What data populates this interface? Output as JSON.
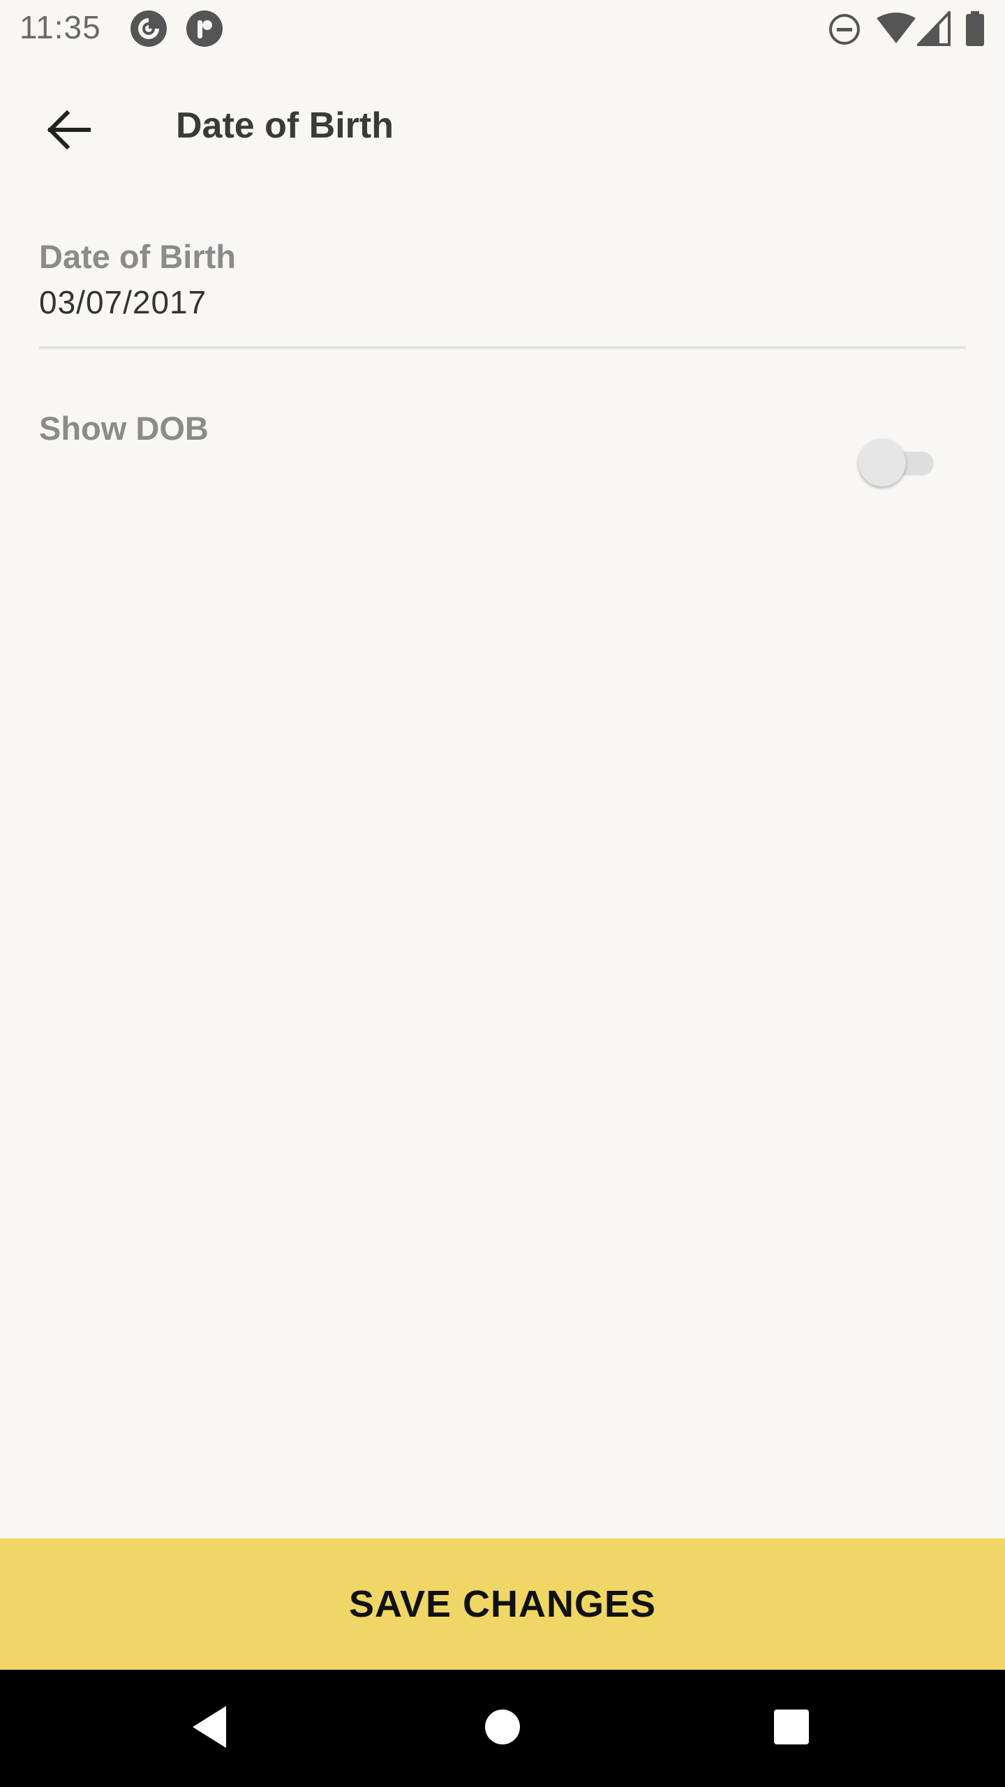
{
  "status_bar": {
    "time": "11:35",
    "left_icons": [
      "pocket-casts-icon",
      "app-r-icon"
    ],
    "right_icons": [
      "do-not-disturb-icon",
      "wifi-icon",
      "signal-icon",
      "battery-icon"
    ]
  },
  "app_bar": {
    "back_icon": "arrow-left-icon",
    "title": "Date of Birth"
  },
  "form": {
    "dob": {
      "label": "Date of Birth",
      "value": "03/07/2017"
    },
    "show_dob": {
      "label": "Show DOB",
      "enabled": false
    }
  },
  "save_button": {
    "label": "SAVE CHANGES",
    "color": "#f0d664"
  },
  "nav_bar": {
    "icons": [
      "back-triangle-icon",
      "home-circle-icon",
      "recents-square-icon"
    ]
  },
  "colors": {
    "background": "#f8f7f4",
    "accent": "#f0d664",
    "label": "#8b8b8b"
  }
}
